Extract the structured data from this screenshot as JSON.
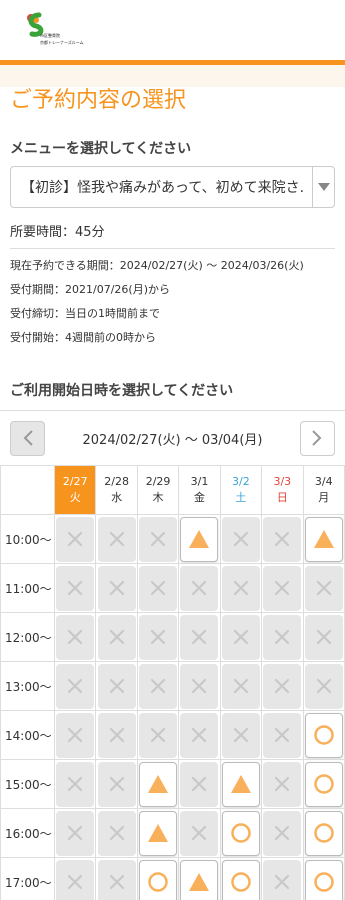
{
  "header": {
    "logo_line1": "市区整骨院",
    "logo_line2": "京都トレーナーズルーム"
  },
  "page_title": "ご予約内容の選択",
  "menu": {
    "label": "メニューを選択してください",
    "selected": "【初診】怪我や痛みがあって、初めて来院さ..."
  },
  "duration": "所要時間：45分",
  "info": [
    "現在予約できる期間：2024/02/27(火) 〜 2024/03/26(火)",
    "受付期間：2021/07/26(月)から",
    "受付締切：当日の1時間前まで",
    "受付開始：4週間前の0時から"
  ],
  "calendar": {
    "label": "ご利用開始日時を選択してください",
    "range": "2024/02/27(火) 〜 03/04(月)",
    "prev_icon": "chevron-left",
    "next_icon": "chevron-right",
    "days": [
      {
        "date": "2/27",
        "dow": "火",
        "kind": "today"
      },
      {
        "date": "2/28",
        "dow": "水",
        "kind": "normal"
      },
      {
        "date": "2/29",
        "dow": "木",
        "kind": "normal"
      },
      {
        "date": "3/1",
        "dow": "金",
        "kind": "normal"
      },
      {
        "date": "3/2",
        "dow": "土",
        "kind": "sat"
      },
      {
        "date": "3/3",
        "dow": "日",
        "kind": "sun"
      },
      {
        "date": "3/4",
        "dow": "月",
        "kind": "normal"
      }
    ],
    "rows": [
      {
        "time": "10:00〜",
        "slots": [
          "x",
          "x",
          "x",
          "tri",
          "x",
          "x",
          "tri"
        ]
      },
      {
        "time": "11:00〜",
        "slots": [
          "x",
          "x",
          "x",
          "x",
          "x",
          "x",
          "x"
        ]
      },
      {
        "time": "12:00〜",
        "slots": [
          "x",
          "x",
          "x",
          "x",
          "x",
          "x",
          "x"
        ]
      },
      {
        "time": "13:00〜",
        "slots": [
          "x",
          "x",
          "x",
          "x",
          "x",
          "x",
          "x"
        ]
      },
      {
        "time": "14:00〜",
        "slots": [
          "x",
          "x",
          "x",
          "x",
          "x",
          "x",
          "o"
        ]
      },
      {
        "time": "15:00〜",
        "slots": [
          "x",
          "x",
          "tri",
          "x",
          "tri",
          "x",
          "o"
        ]
      },
      {
        "time": "16:00〜",
        "slots": [
          "x",
          "x",
          "tri",
          "x",
          "o",
          "x",
          "o"
        ]
      },
      {
        "time": "17:00〜",
        "slots": [
          "x",
          "x",
          "o",
          "tri",
          "o",
          "x",
          "o"
        ]
      }
    ]
  },
  "colors": {
    "accent": "#f7941d",
    "saturday": "#3aa3d8",
    "sunday": "#e0453a",
    "closed": "#e6e6e6"
  }
}
